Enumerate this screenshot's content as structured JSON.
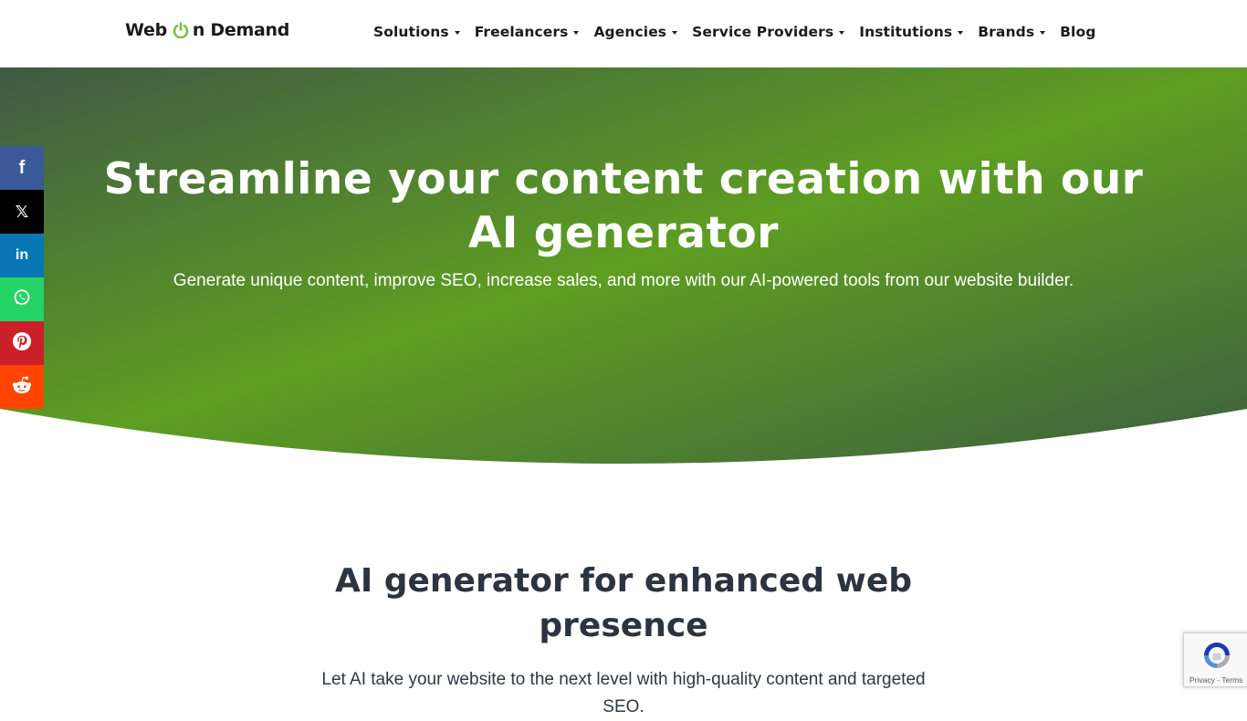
{
  "header": {
    "logo": {
      "text_before": "Web",
      "text_after": "n Demand",
      "accent_color": "#7ac143"
    },
    "nav": [
      {
        "label": "Solutions",
        "has_dropdown": true
      },
      {
        "label": "Freelancers",
        "has_dropdown": true
      },
      {
        "label": "Agencies",
        "has_dropdown": true
      },
      {
        "label": "Service Providers",
        "has_dropdown": true
      },
      {
        "label": "Institutions",
        "has_dropdown": true
      },
      {
        "label": "Brands",
        "has_dropdown": true
      },
      {
        "label": "Blog",
        "has_dropdown": false
      }
    ]
  },
  "hero": {
    "title_line1": "Streamline your content creation with our",
    "title_line2": "AI generator",
    "subtitle": "Generate unique content, improve SEO, increase sales, and more with our AI-powered tools from our website builder.",
    "gradient": {
      "start": "#3f5a44",
      "middle": "#5e9e22",
      "end": "#3d5e40"
    }
  },
  "share": [
    {
      "name": "facebook",
      "icon": "facebook-icon",
      "glyph": "f",
      "color": "#3b5998"
    },
    {
      "name": "x",
      "icon": "x-icon",
      "glyph": "𝕏",
      "color": "#000000"
    },
    {
      "name": "linkedin",
      "icon": "linkedin-icon",
      "glyph": "in",
      "color": "#0a77b5"
    },
    {
      "name": "whatsapp",
      "icon": "whatsapp-icon",
      "glyph": "",
      "color": "#25d366"
    },
    {
      "name": "pinterest",
      "icon": "pinterest-icon",
      "glyph": "",
      "color": "#cb2027"
    },
    {
      "name": "reddit",
      "icon": "reddit-icon",
      "glyph": "",
      "color": "#ff4500"
    }
  ],
  "section": {
    "title_line1": "AI generator for enhanced web",
    "title_line2": "presence",
    "text": "Let AI take your website to the next level with high-quality content and targeted SEO."
  },
  "recaptcha": {
    "privacy": "Privacy",
    "separator": " - ",
    "terms": "Terms"
  }
}
